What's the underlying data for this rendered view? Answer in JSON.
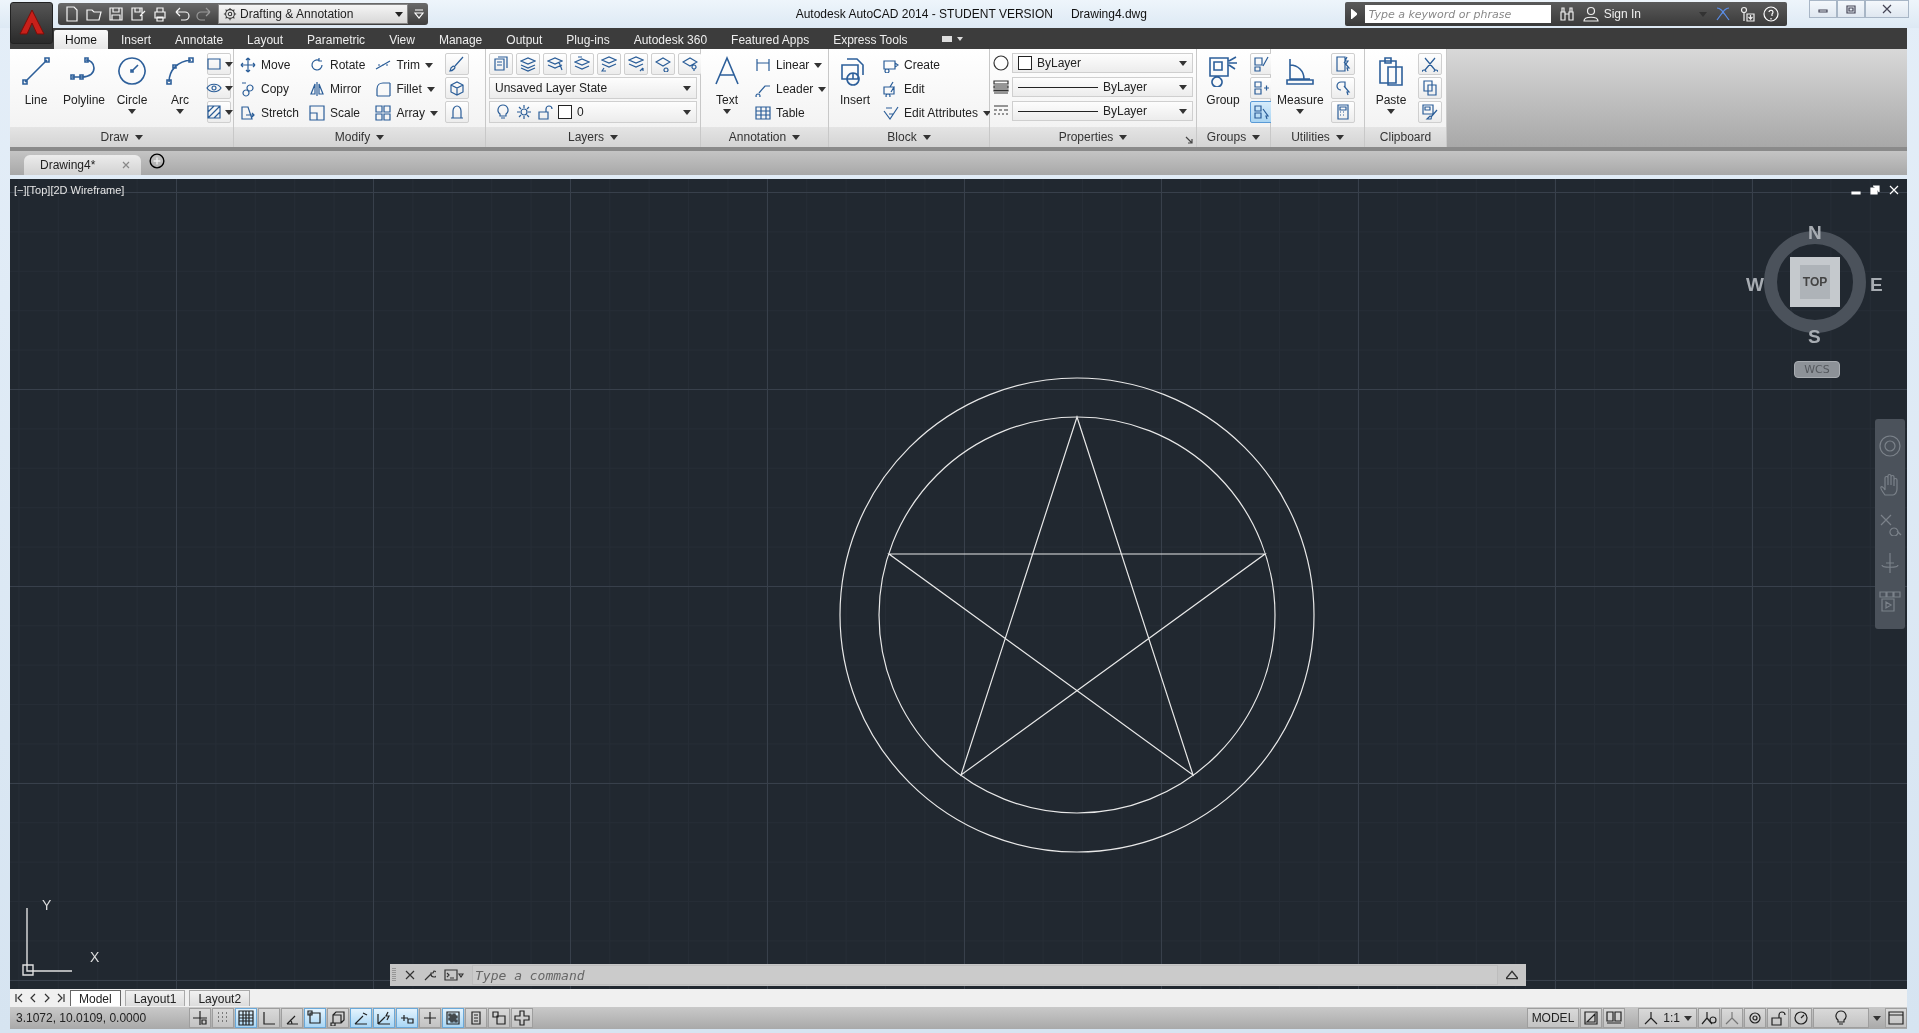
{
  "title_bar": {
    "workspace": "Drafting & Annotation",
    "title": "Autodesk AutoCAD 2014 - STUDENT VERSION",
    "filename": "Drawing4.dwg",
    "search": {
      "placeholder": "Type a keyword or phrase"
    },
    "sign_in": "Sign In"
  },
  "ribbon_tabs": [
    {
      "label": "Home",
      "selected": true
    },
    {
      "label": "Insert",
      "selected": false
    },
    {
      "label": "Annotate",
      "selected": false
    },
    {
      "label": "Layout",
      "selected": false
    },
    {
      "label": "Parametric",
      "selected": false
    },
    {
      "label": "View",
      "selected": false
    },
    {
      "label": "Manage",
      "selected": false
    },
    {
      "label": "Output",
      "selected": false
    },
    {
      "label": "Plug-ins",
      "selected": false
    },
    {
      "label": "Autodesk 360",
      "selected": false
    },
    {
      "label": "Featured Apps",
      "selected": false
    },
    {
      "label": "Express Tools",
      "selected": false
    }
  ],
  "panels": [
    {
      "kind": "tools",
      "title": "Draw",
      "menu": true,
      "launcher": false,
      "tools": [
        {
          "kind": "large",
          "label": "Line",
          "dropdown": false
        },
        {
          "kind": "large",
          "label": "Polyline",
          "dropdown": false
        },
        {
          "kind": "large",
          "label": "Circle",
          "dropdown": true
        },
        {
          "kind": "large",
          "label": "Arc",
          "dropdown": true
        }
      ]
    },
    {
      "kind": "tools",
      "title": "Modify",
      "menu": true,
      "launcher": false,
      "tools": [
        {
          "kind": "small",
          "label": "Move",
          "dropdown": false
        },
        {
          "kind": "small",
          "label": "Copy",
          "dropdown": false
        },
        {
          "kind": "small",
          "label": "Stretch",
          "dropdown": false
        },
        {
          "kind": "small",
          "label": "Rotate",
          "dropdown": false
        },
        {
          "kind": "small",
          "label": "Mirror",
          "dropdown": false
        },
        {
          "kind": "small",
          "label": "Scale",
          "dropdown": false
        },
        {
          "kind": "small",
          "label": "Trim",
          "dropdown": true
        },
        {
          "kind": "small",
          "label": "Fillet",
          "dropdown": true
        },
        {
          "kind": "small",
          "label": "Array",
          "dropdown": true
        }
      ]
    },
    {
      "kind": "layers",
      "title": "Layers",
      "menu": true,
      "launcher": false,
      "layer_state": "Unsaved Layer State",
      "current_layer": "0"
    },
    {
      "kind": "tools",
      "title": "Annotation",
      "menu": true,
      "launcher": false,
      "tools": [
        {
          "kind": "large",
          "label": "Text",
          "dropdown": true
        },
        {
          "kind": "small",
          "label": "Linear",
          "dropdown": true
        },
        {
          "kind": "small",
          "label": "Leader",
          "dropdown": true
        },
        {
          "kind": "small",
          "label": "Table",
          "dropdown": false
        }
      ]
    },
    {
      "kind": "tools",
      "title": "Block",
      "menu": true,
      "launcher": false,
      "tools": [
        {
          "kind": "large",
          "label": "Insert",
          "dropdown": false
        },
        {
          "kind": "small",
          "label": "Create",
          "dropdown": false
        },
        {
          "kind": "small",
          "label": "Edit",
          "dropdown": false
        },
        {
          "kind": "small",
          "label": "Edit Attributes",
          "dropdown": true
        }
      ]
    },
    {
      "kind": "properties",
      "title": "Properties",
      "menu": true,
      "launcher": true,
      "object_color": "ByLayer",
      "lineweight": "ByLayer",
      "linetype": "ByLayer"
    },
    {
      "kind": "tools",
      "title": "Groups",
      "menu": true,
      "launcher": false,
      "group_selection": {
        "on": true
      },
      "tools": [
        {
          "kind": "large",
          "label": "Group",
          "dropdown": false
        }
      ]
    },
    {
      "kind": "tools",
      "title": "Utilities",
      "menu": true,
      "launcher": false,
      "tools": [
        {
          "kind": "large",
          "label": "Measure",
          "dropdown": true
        }
      ]
    },
    {
      "kind": "tools",
      "title": "Clipboard",
      "menu": false,
      "launcher": false,
      "tools": [
        {
          "kind": "large",
          "label": "Paste",
          "dropdown": true
        }
      ]
    }
  ],
  "document_tabs": [
    {
      "label": "Drawing4*",
      "selected": true
    }
  ],
  "viewport": {
    "label": "[−][Top][2D Wireframe]",
    "viewcube": {
      "north": "N",
      "south": "S",
      "east": "E",
      "west": "W",
      "face": "TOP",
      "ucs": "WCS"
    },
    "ucs_icon": {
      "x": "X",
      "y": "Y"
    }
  },
  "command_line": {
    "placeholder": "Type a command"
  },
  "layout_tabs": [
    {
      "label": "Model",
      "selected": true
    },
    {
      "label": "Layout1",
      "selected": false
    },
    {
      "label": "Layout2",
      "selected": false
    }
  ],
  "status_bar": {
    "coordinates": "3.1072, 10.0109, 0.0000",
    "toggles": [
      {
        "on": false
      },
      {
        "on": false
      },
      {
        "on": true
      },
      {
        "on": false
      },
      {
        "on": false
      },
      {
        "on": true
      },
      {
        "on": false
      },
      {
        "on": true
      },
      {
        "on": true
      },
      {
        "on": true
      },
      {
        "on": false
      },
      {
        "on": true
      },
      {
        "on": false
      },
      {
        "on": false
      },
      {
        "on": false
      }
    ],
    "space": "MODEL",
    "annotation_scale": "1:1"
  }
}
